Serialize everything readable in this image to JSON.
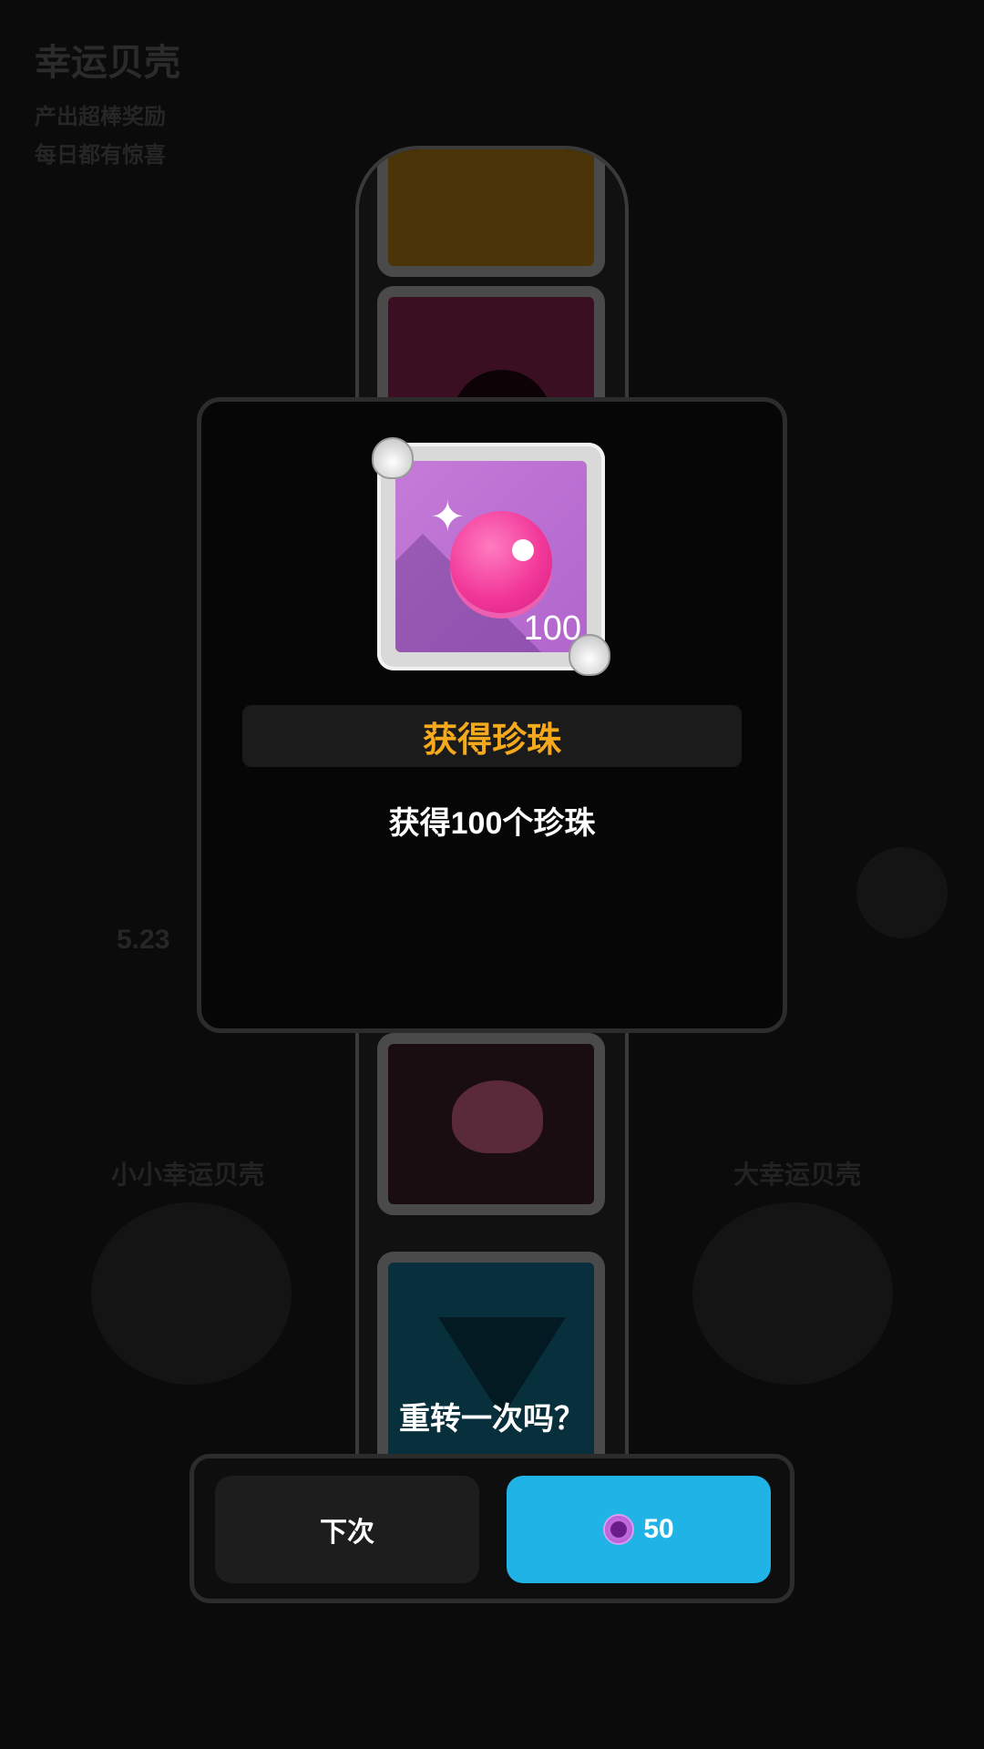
{
  "background": {
    "title": "幸运贝壳",
    "line1": "产出超棒奖励",
    "line2": "每日都有惊喜",
    "left_label": "小小幸运贝壳",
    "right_label": "大幸运贝壳",
    "value": "5.23"
  },
  "reward": {
    "item_icon": "pearl-icon",
    "quantity": "100",
    "title": "获得珍珠",
    "description": "获得100个珍珠"
  },
  "prompt": {
    "question": "重转一次吗？",
    "next_label": "下次",
    "retry_cost": "50",
    "retry_currency_icon": "pearl-coin-icon"
  },
  "colors": {
    "title_accent": "#f5a91b",
    "retry_button": "#20b3e6",
    "pearl_tile": "#c67ad8"
  }
}
